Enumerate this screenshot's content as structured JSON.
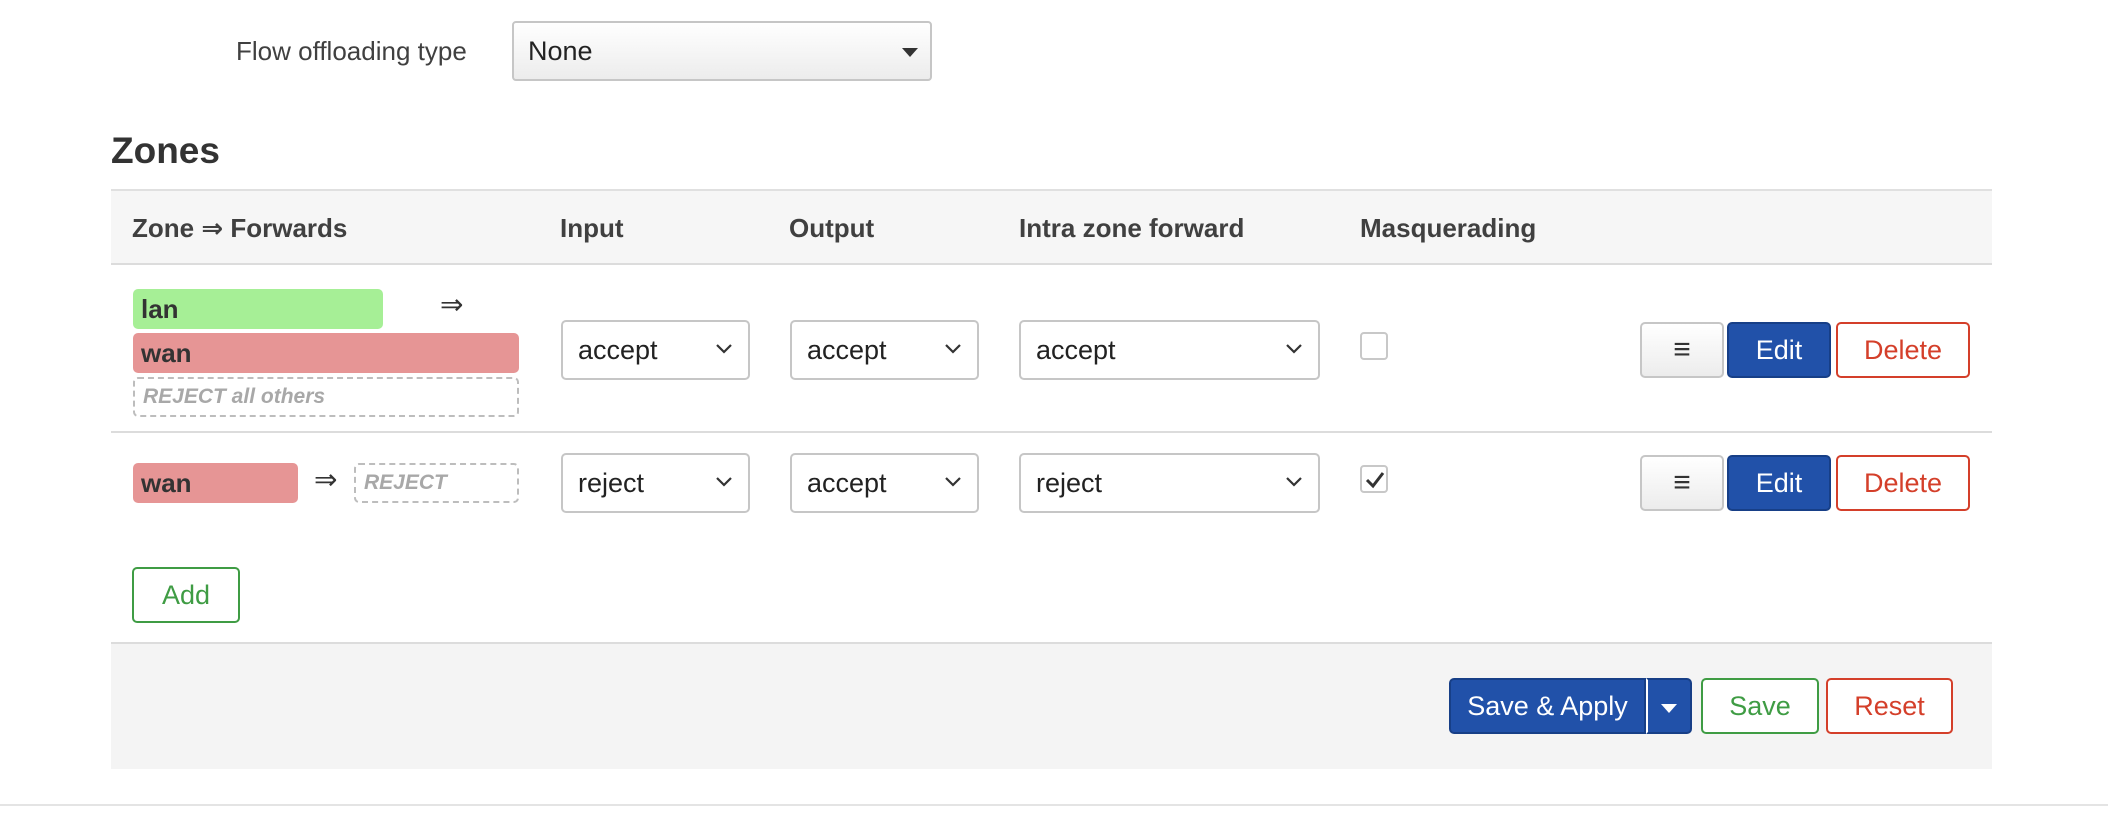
{
  "settings": {
    "flow_offloading_label": "Flow offloading type",
    "flow_offloading_value": "None"
  },
  "zones": {
    "title": "Zones",
    "columns": {
      "zone_forwards": "Zone ⇒ Forwards",
      "input": "Input",
      "output": "Output",
      "intra": "Intra zone forward",
      "masquerading": "Masquerading"
    },
    "rows": [
      {
        "zone": "lan",
        "zone_color": "#a6ef96",
        "arrow": "⇒",
        "forward_dest": "wan",
        "forward_dest_color": "#e69595",
        "forward_default": "REJECT all others",
        "input": "accept",
        "output": "accept",
        "intra": "accept",
        "masquerading": false,
        "more_label": "≡",
        "edit_label": "Edit",
        "delete_label": "Delete"
      },
      {
        "zone": "wan",
        "zone_color": "#e69595",
        "arrow": "⇒",
        "forward_default": "REJECT",
        "input": "reject",
        "output": "accept",
        "intra": "reject",
        "masquerading": true,
        "more_label": "≡",
        "edit_label": "Edit",
        "delete_label": "Delete"
      }
    ],
    "add_label": "Add"
  },
  "footer": {
    "save_apply_label": "Save & Apply",
    "save_label": "Save",
    "reset_label": "Reset"
  },
  "colors": {
    "primary": "#2151a9",
    "positive": "#3f9c44",
    "negative": "#d43f2a"
  }
}
